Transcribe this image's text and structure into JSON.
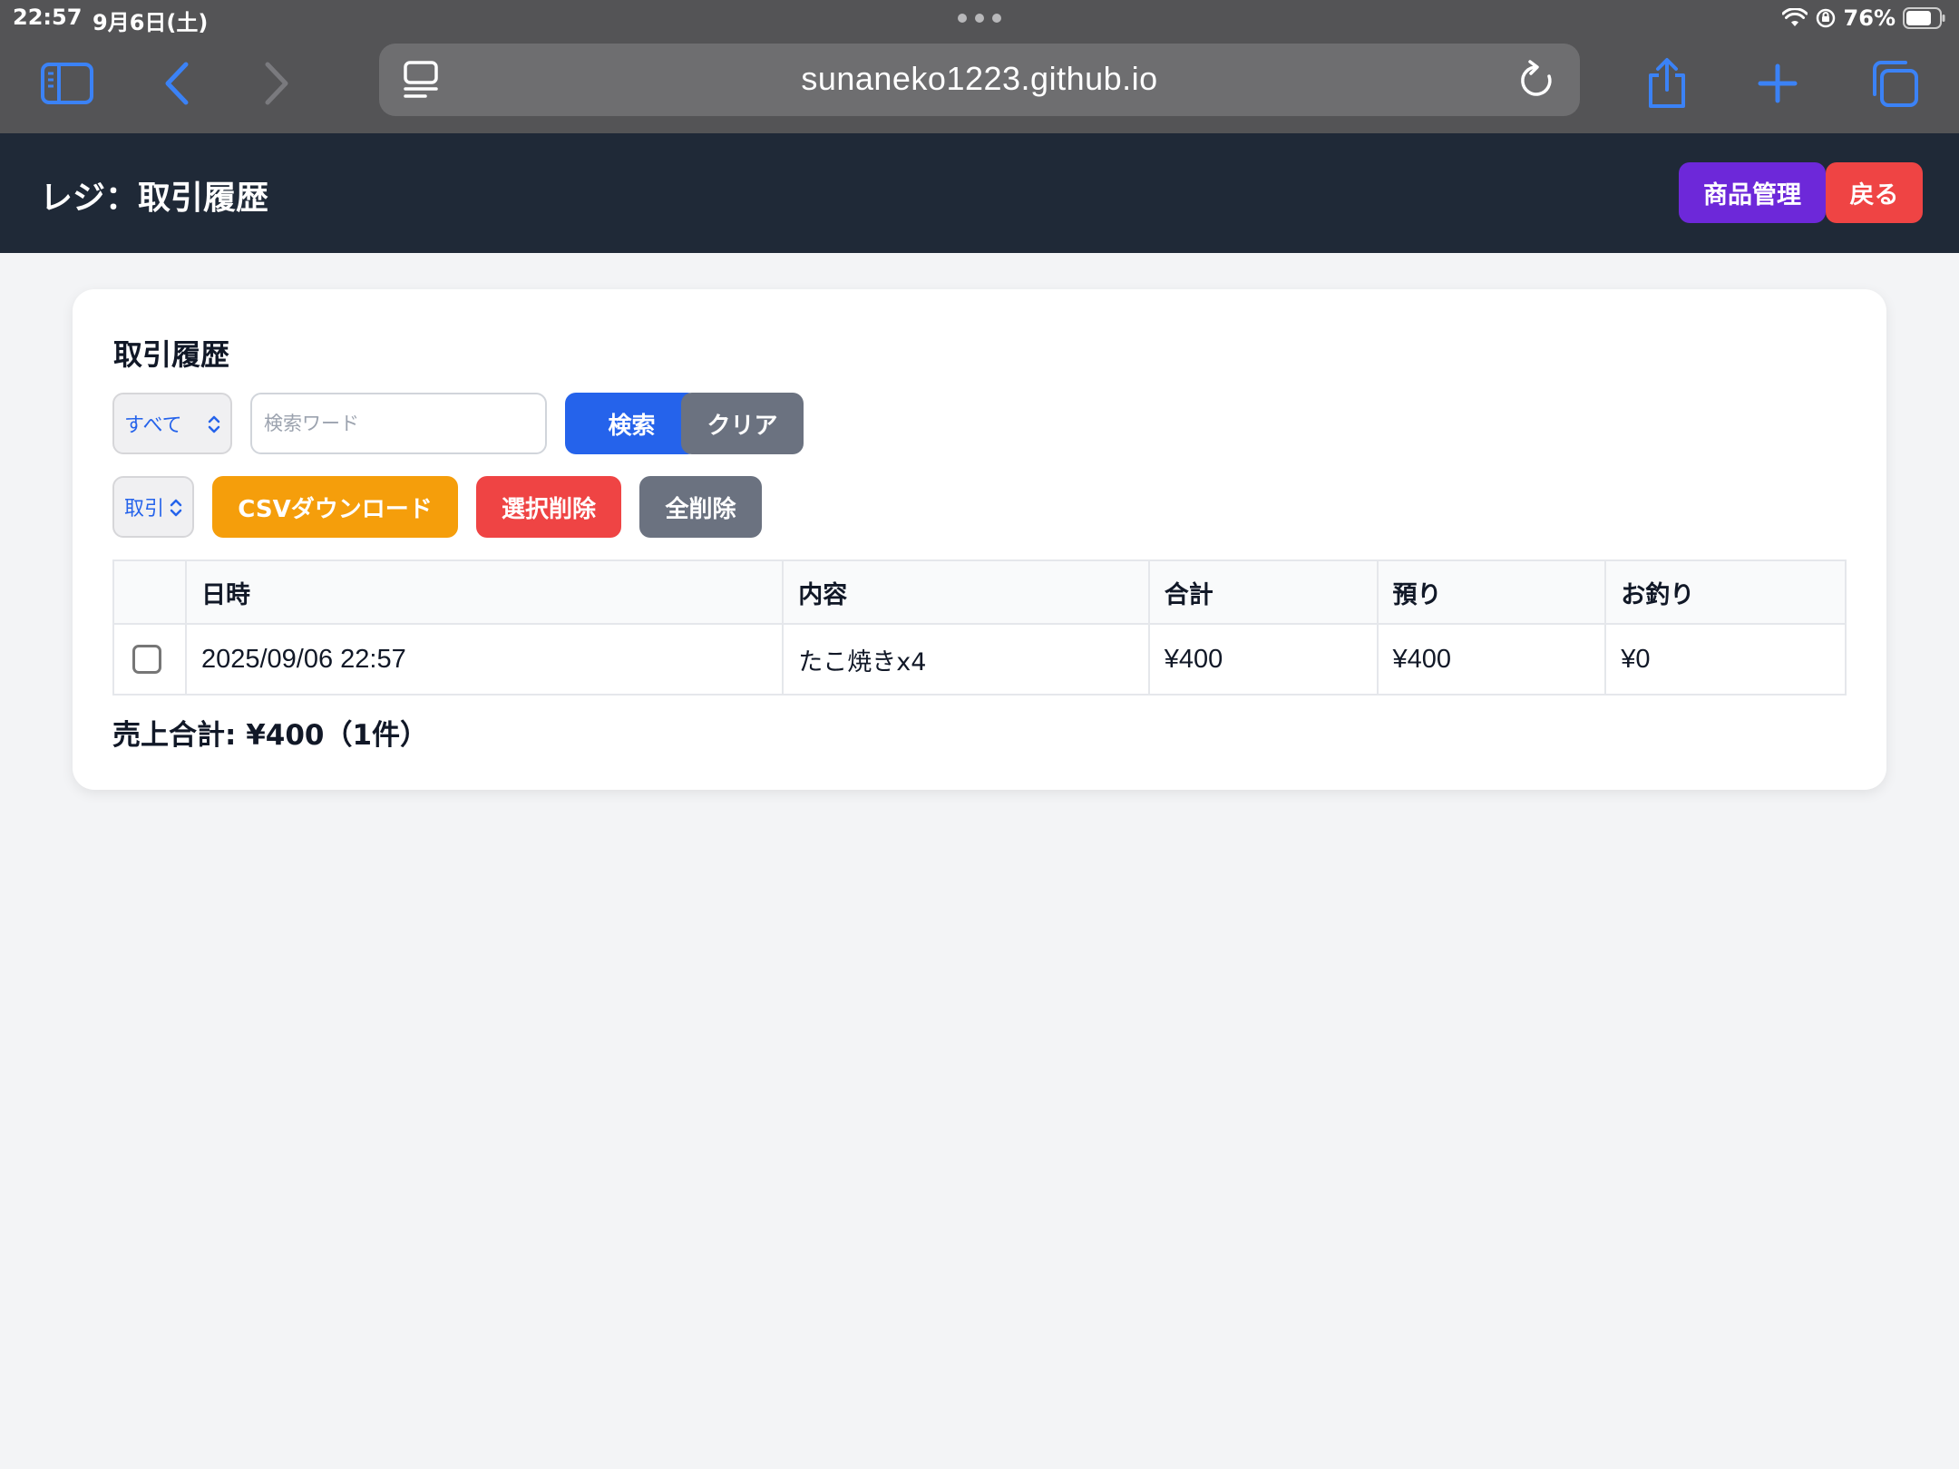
{
  "status_bar": {
    "time": "22:57",
    "date": "9月6日(土)",
    "battery": "76%"
  },
  "browser": {
    "url": "sunaneko1223.github.io",
    "accent_color": "#3b82f6"
  },
  "header": {
    "title": "レジ：取引履歴",
    "products_button": "商品管理",
    "back_button": "戻る",
    "colors": {
      "bg": "#1f2937",
      "products": "#6d28d9",
      "back": "#ef4444"
    }
  },
  "main": {
    "title": "取引履歴",
    "filter_select": {
      "selected": "すべて"
    },
    "search_input": {
      "value": "",
      "placeholder": "検索ワード"
    },
    "search_button": "検索",
    "clear_button": "クリア",
    "type_select": {
      "selected": "取引"
    },
    "csv_button": "CSVダウンロード",
    "delete_selected_button": "選択削除",
    "delete_all_button": "全削除",
    "table": {
      "columns": [
        "",
        "日時",
        "内容",
        "合計",
        "預り",
        "お釣り"
      ],
      "rows": [
        {
          "checked": false,
          "datetime": "2025/09/06 22:57",
          "content": "たこ焼きx4",
          "total": "¥400",
          "received": "¥400",
          "change": "¥0"
        }
      ]
    },
    "sales_total": "売上合計: ¥400（1件）"
  }
}
